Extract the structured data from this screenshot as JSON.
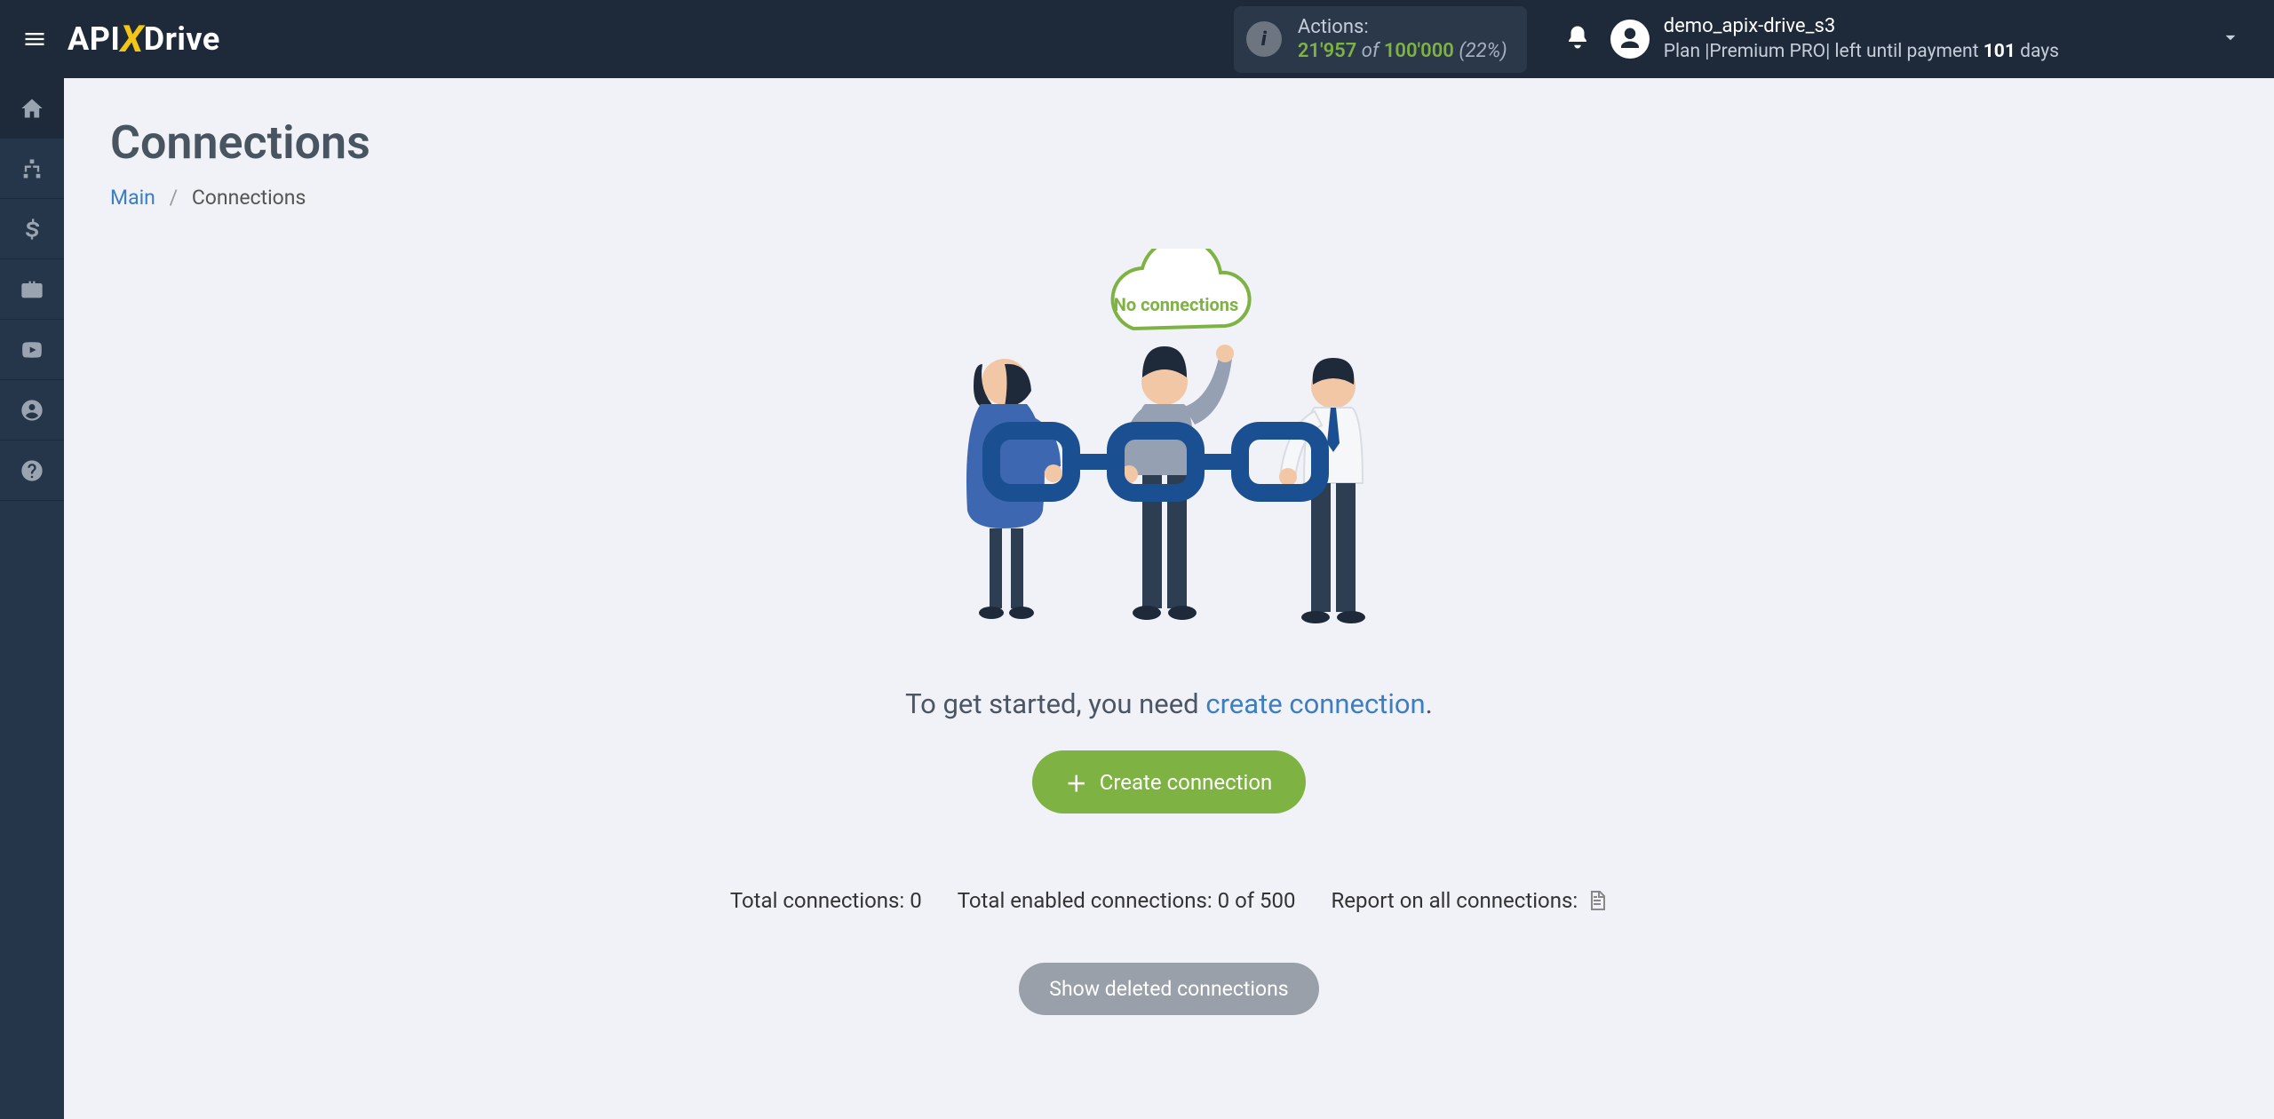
{
  "header": {
    "logo_1": "API",
    "logo_x": "X",
    "logo_2": "Drive",
    "actions_label": "Actions:",
    "actions_used": "21'957",
    "actions_of": "of",
    "actions_limit": "100'000",
    "actions_pct": "(22%)",
    "username": "demo_apix-drive_s3",
    "plan_prefix": "Plan |Premium PRO| left until payment ",
    "plan_days": "101",
    "plan_suffix": " days"
  },
  "sidebar": {
    "items": [
      "home",
      "sitemap",
      "money",
      "briefcase",
      "youtube",
      "user",
      "help"
    ]
  },
  "page": {
    "title": "Connections",
    "bc_main": "Main",
    "bc_current": "Connections"
  },
  "empty": {
    "cloud_text": "No connections",
    "help_prefix": "To get started, you need ",
    "help_link": "create connection",
    "help_suffix": ".",
    "create_btn": "Create connection",
    "stat_total": "Total connections: 0",
    "stat_enabled": "Total enabled connections: 0 of 500",
    "stat_report": "Report on all connections:",
    "deleted_btn": "Show deleted connections"
  },
  "colors": {
    "accent": "#7eb343",
    "link": "#3b7ec2",
    "header": "#1e2a3a"
  }
}
